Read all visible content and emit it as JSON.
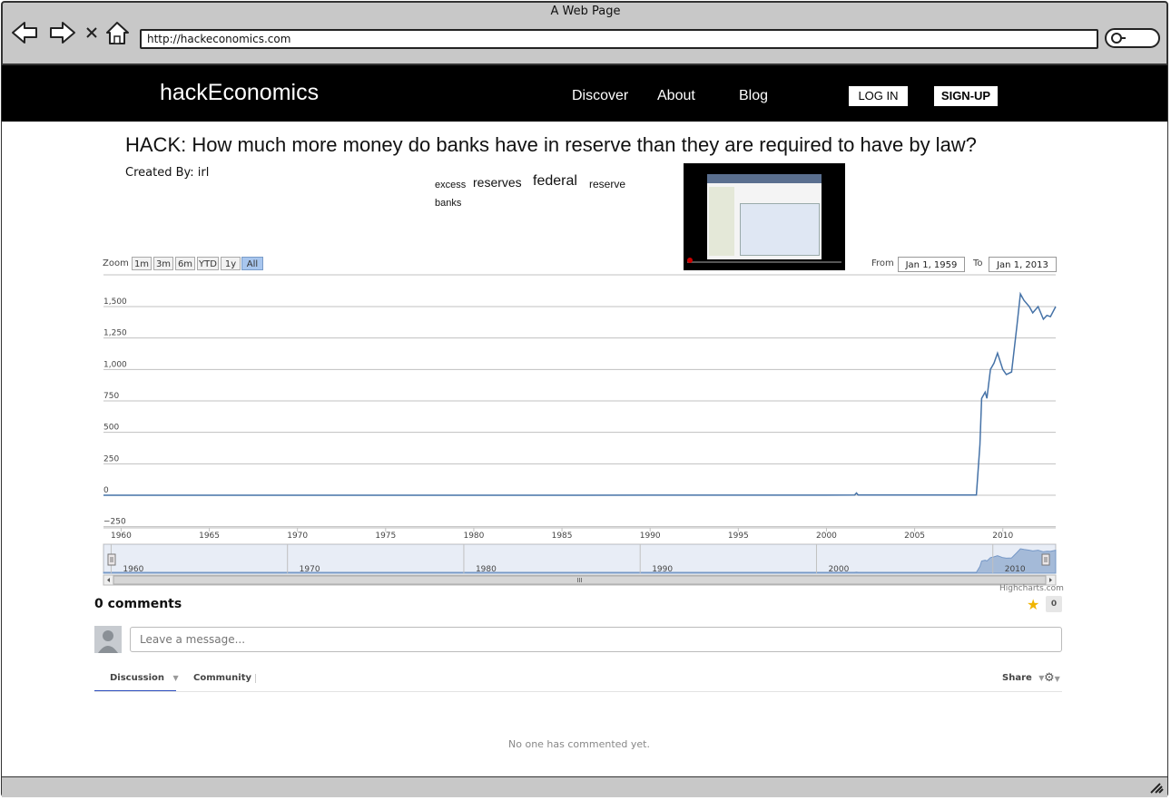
{
  "browser": {
    "window_title": "A Web Page",
    "url": "http://hackeconomics.com"
  },
  "nav": {
    "brand": "hackEconomics",
    "links": [
      "Discover",
      "About",
      "Blog"
    ],
    "login": "LOG IN",
    "signup": "SIGN-UP"
  },
  "hack": {
    "title": "HACK: How much more money do banks have in reserve than they are required to have by law?",
    "created_by": "Created By: irl",
    "tags": [
      "excess",
      "reserves",
      "federal",
      "reserve",
      "banks"
    ]
  },
  "chart_controls": {
    "zoom_label": "Zoom",
    "zoom_options": [
      "1m",
      "3m",
      "6m",
      "YTD",
      "1y",
      "All"
    ],
    "selected_zoom": "All",
    "from_label": "From",
    "from_value": "Jan 1, 1959",
    "to_label": "To",
    "to_value": "Jan 1, 2013",
    "credit": "Highcharts.com"
  },
  "chart_data": {
    "type": "line",
    "title": "",
    "xlabel": "",
    "ylabel": "",
    "xlim": [
      1959,
      2013
    ],
    "ylim": [
      -250,
      1700
    ],
    "yticks": [
      -250,
      0,
      250,
      500,
      750,
      1000,
      1250,
      1500
    ],
    "xticks": [
      1960,
      1965,
      1970,
      1975,
      1980,
      1985,
      1990,
      1995,
      2000,
      2005,
      2010
    ],
    "navigator_ticks": [
      1960,
      1970,
      1980,
      1990,
      2000,
      2010
    ],
    "grid": true,
    "series": [
      {
        "color": "#4572a7",
        "x": [
          1959,
          1970,
          1980,
          1990,
          2000,
          2001.6,
          2001.7,
          2001.8,
          2008.5,
          2008.7,
          2008.8,
          2009.0,
          2009.1,
          2009.3,
          2009.5,
          2009.7,
          2010.0,
          2010.2,
          2010.5,
          2010.8,
          2011.0,
          2011.2,
          2011.5,
          2011.7,
          2012.0,
          2012.3,
          2012.5,
          2012.7,
          2013.0
        ],
        "y": [
          0,
          0,
          0,
          1,
          1,
          2,
          18,
          2,
          2,
          400,
          770,
          820,
          770,
          1000,
          1050,
          1130,
          1000,
          960,
          980,
          1350,
          1600,
          1550,
          1500,
          1450,
          1500,
          1400,
          1430,
          1420,
          1500
        ]
      }
    ]
  },
  "comments": {
    "count_label": "0 comments",
    "recommend_count": "0",
    "input_placeholder": "Leave a message...",
    "tab_discussion": "Discussion",
    "tab_community": "Community",
    "share_label": "Share",
    "empty_message": "No one has commented yet."
  }
}
